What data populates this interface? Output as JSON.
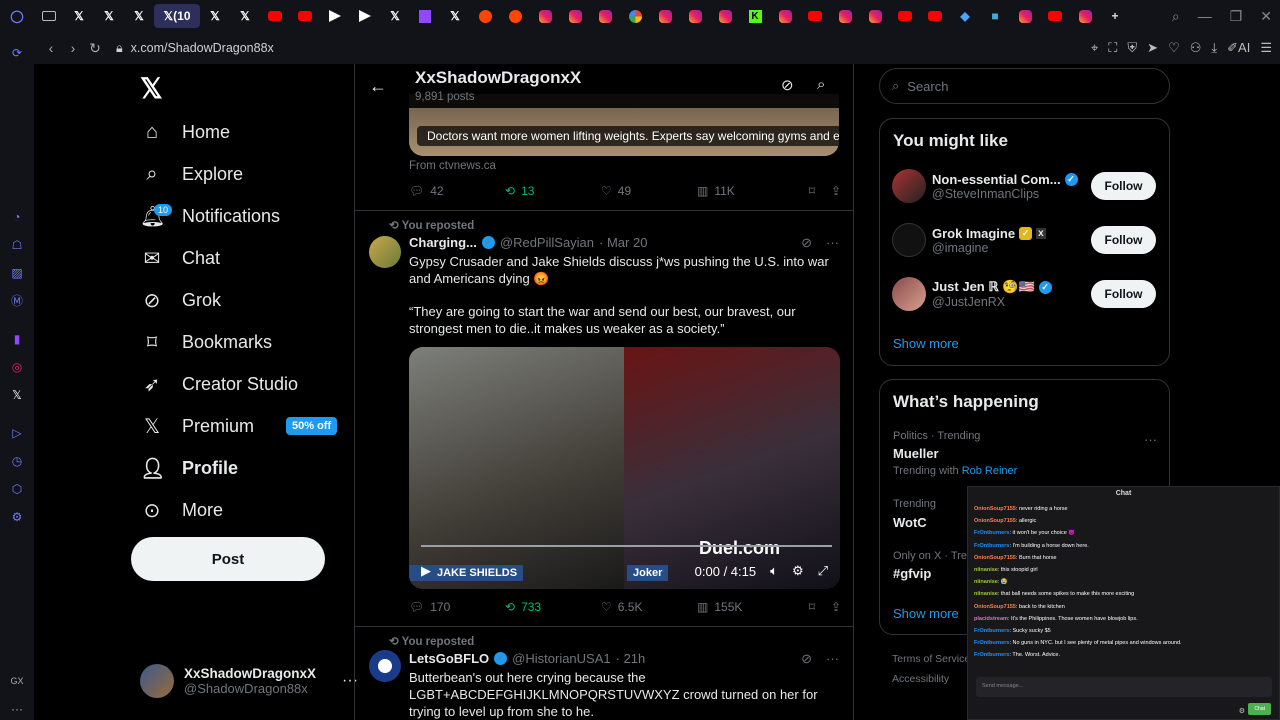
{
  "browser": {
    "tabs": [
      "mail",
      "x",
      "x",
      "x",
      "x (10",
      "x",
      "x",
      "youtube",
      "youtube",
      "red",
      "red",
      "x",
      "twitch",
      "x",
      "reddit",
      "reddit",
      "instagram",
      "instagram",
      "instagram",
      "google",
      "instagram",
      "instagram",
      "instagram",
      "kick",
      "instagram",
      "youtube",
      "instagram",
      "instagram",
      "youtube",
      "youtube",
      "app",
      "app",
      "instagram",
      "youtube",
      "instagram"
    ],
    "active_tab_label": "(10",
    "url": "x.com/ShadowDragon88x",
    "ai_label": "AI"
  },
  "nav": {
    "home": "Home",
    "explore": "Explore",
    "notifications": "Notifications",
    "notif_badge": "10",
    "chat": "Chat",
    "grok": "Grok",
    "bookmarks": "Bookmarks",
    "creator": "Creator Studio",
    "premium": "Premium",
    "premium_promo": "50% off",
    "profile": "Profile",
    "more": "More",
    "post": "Post"
  },
  "account": {
    "name": "XxShadowDragonxX",
    "handle": "@ShadowDragon88x"
  },
  "feed_header": {
    "title": "XxShadowDragonxX",
    "posts": "9,891 posts"
  },
  "post0": {
    "card_caption": "Doctors want more women lifting weights. Experts say welcoming gyms and e...",
    "from": "From ctvnews.ca",
    "replies": "42",
    "reposts": "13",
    "likes": "49",
    "views": "11K"
  },
  "post1": {
    "repost_label": "You reposted",
    "name": "Charging...",
    "handle": "@RedPillSayian",
    "date": "· Mar 20",
    "text1": "Gypsy Crusader and Jake Shields discuss j*ws pushing the U.S. into war and Americans dying 😡",
    "text2": "“They are going to start the war and send our best, our bravest, our strongest men to die..it makes us weaker as a society.”",
    "video_time": "0:00 / 4:15",
    "tag_left": "JAKE SHIELDS",
    "tag_right": "Joker",
    "watermark": "Duel.com",
    "replies": "170",
    "reposts": "733",
    "likes": "6.5K",
    "views": "155K"
  },
  "post2": {
    "repost_label": "You reposted",
    "name": "LetsGoBFLO",
    "handle": "@HistorianUSA1",
    "date": "· 21h",
    "text": "Butterbean's out here crying because the LGBT+ABCDEFGHIJKLMNOPQRSTUVWXYZ crowd turned on her for trying to level up from she to he."
  },
  "search": {
    "placeholder": "Search"
  },
  "you_might_like": {
    "title": "You might like",
    "items": [
      {
        "name": "Non-essential Com...",
        "handle": "@SteveInmanClips",
        "follow": "Follow"
      },
      {
        "name": "Grok Imagine",
        "handle": "@imagine",
        "follow": "Follow"
      },
      {
        "name": "Just Jen ℝ 🧐🇺🇸",
        "handle": "@JustJenRX",
        "follow": "Follow"
      }
    ],
    "show_more": "Show more"
  },
  "happening": {
    "title": "What’s happening",
    "t1_meta": "Politics · Trending",
    "t1_name": "Mueller",
    "t1_with": "Trending with",
    "t1_link": "Rob Reiner",
    "t2_meta": "Trending",
    "t2_name": "WotC",
    "t3_meta": "Only on X · Trending",
    "t3_name": "#gfvip",
    "show_more": "Show more"
  },
  "footer": {
    "terms": "Terms of Service",
    "accessibility": "Accessibility"
  },
  "chat": {
    "title": "Chat",
    "messages": [
      {
        "user": "OnionSoup7155",
        "text": "never riding a horse"
      },
      {
        "user": "OnionSoup7155",
        "text": "allergic"
      },
      {
        "user": "FrOntburners",
        "text": "it won't be your choice 😈"
      },
      {
        "user": "FrOntburners",
        "text": "I'm building a horse down here."
      },
      {
        "user": "OnionSoup7155",
        "text": "Burn that horse"
      },
      {
        "user": "niinanise",
        "text": "this stoopid girl"
      },
      {
        "user": "niinanise",
        "text": "😭"
      },
      {
        "user": "niinanise",
        "text": "that ball needs some spikes to make this more exciting"
      },
      {
        "user": "OnionSoup7155",
        "text": "back to the kitchen"
      },
      {
        "user": "placidstream",
        "text": "It's the Philippines. Those women have blowjob lips."
      },
      {
        "user": "FrOntburners",
        "text": "Sucky sucky $5"
      },
      {
        "user": "FrOntburners",
        "text": "No guns in NYC. but I see plenty of metal pipes and windows around."
      },
      {
        "user": "FrOntburners",
        "text": "The. Worst. Advice."
      }
    ],
    "input_placeholder": "Send message...",
    "send": "Chat"
  }
}
